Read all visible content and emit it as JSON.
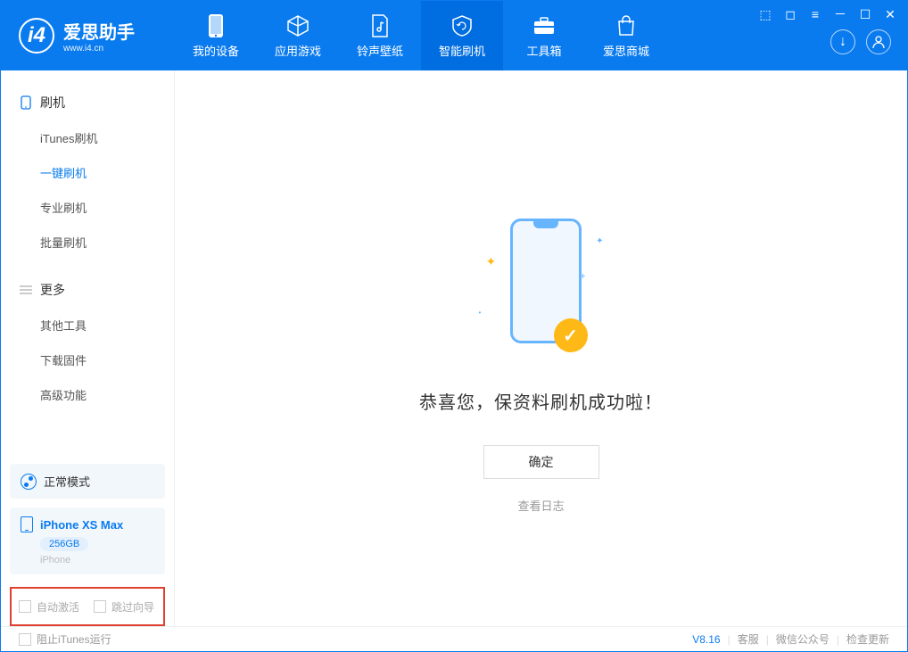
{
  "app": {
    "title": "爱思助手",
    "subtitle": "www.i4.cn"
  },
  "tabs": [
    {
      "label": "我的设备"
    },
    {
      "label": "应用游戏"
    },
    {
      "label": "铃声壁纸"
    },
    {
      "label": "智能刷机"
    },
    {
      "label": "工具箱"
    },
    {
      "label": "爱思商城"
    }
  ],
  "sidebar": {
    "section1": {
      "title": "刷机",
      "items": [
        "iTunes刷机",
        "一键刷机",
        "专业刷机",
        "批量刷机"
      ]
    },
    "section2": {
      "title": "更多",
      "items": [
        "其他工具",
        "下载固件",
        "高级功能"
      ]
    }
  },
  "device": {
    "mode": "正常模式",
    "name": "iPhone XS Max",
    "capacity": "256GB",
    "type": "iPhone"
  },
  "options": {
    "auto_activate": "自动激活",
    "skip_guide": "跳过向导"
  },
  "main": {
    "success": "恭喜您，保资料刷机成功啦！",
    "ok": "确定",
    "view_log": "查看日志"
  },
  "footer": {
    "block_itunes": "阻止iTunes运行",
    "version": "V8.16",
    "service": "客服",
    "wechat": "微信公众号",
    "update": "检查更新"
  }
}
